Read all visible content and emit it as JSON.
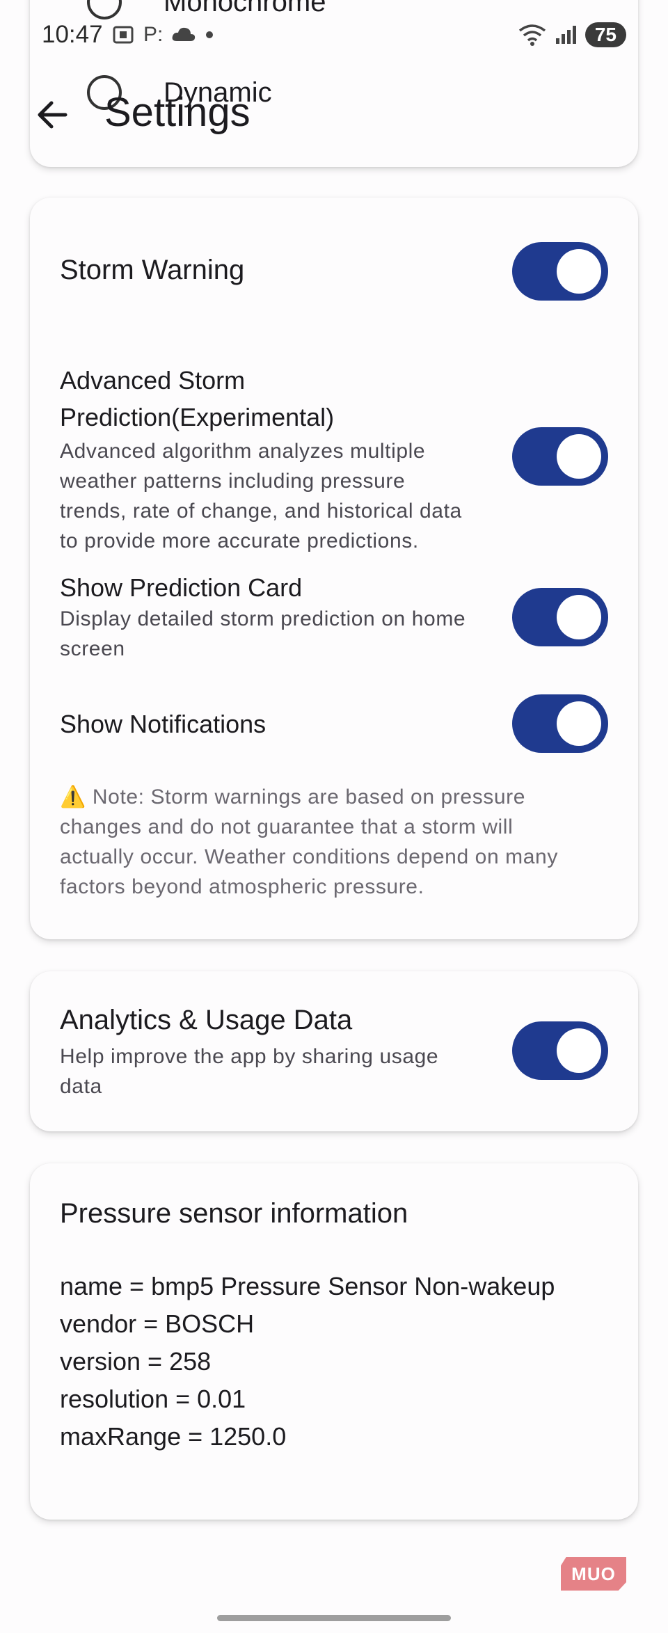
{
  "status_bar": {
    "time": "10:47",
    "left_icons": [
      "screenshot-icon",
      "p-icon",
      "cloud-icon",
      "dot-icon"
    ],
    "right_icons": [
      "wifi-icon",
      "signal-icon"
    ],
    "battery": "75"
  },
  "theme_options": [
    {
      "label": "Monochrome"
    },
    {
      "label": "Dynamic"
    }
  ],
  "header": {
    "title": "Settings"
  },
  "storm": {
    "title": "Storm Warning",
    "advanced_title_line1": "Advanced Storm",
    "advanced_title_line2": "Prediction(Experimental)",
    "advanced_desc_lines": [
      "Advanced algorithm analyzes multiple",
      "weather patterns including pressure",
      "trends, rate of change, and historical data",
      "to provide more accurate predictions."
    ],
    "card_title": "Show Prediction Card",
    "card_desc_lines": [
      "Display detailed storm prediction on home",
      "screen"
    ],
    "notifications_title": "Show Notifications",
    "note_lines": [
      "⚠️ Note: Storm warnings are based on pressure",
      "changes and do not guarantee that a storm will",
      "actually occur. Weather conditions depend on many",
      "factors beyond atmospheric pressure."
    ],
    "toggles": {
      "storm_warning": true,
      "advanced": true,
      "prediction_card": true,
      "notifications": true
    }
  },
  "analytics": {
    "title": "Analytics & Usage Data",
    "desc_lines": [
      "Help improve the app by sharing usage",
      "data"
    ],
    "enabled": true
  },
  "sensor": {
    "title": "Pressure sensor information",
    "lines": [
      "name = bmp5 Pressure Sensor Non-wakeup",
      "vendor = BOSCH",
      "version = 258",
      "resolution = 0.01",
      "maxRange = 1250.0"
    ]
  },
  "watermark": "MUO",
  "colors": {
    "toggle_on": "#1f3a8f",
    "background": "#fdfcfd",
    "watermark": "#e58287"
  }
}
